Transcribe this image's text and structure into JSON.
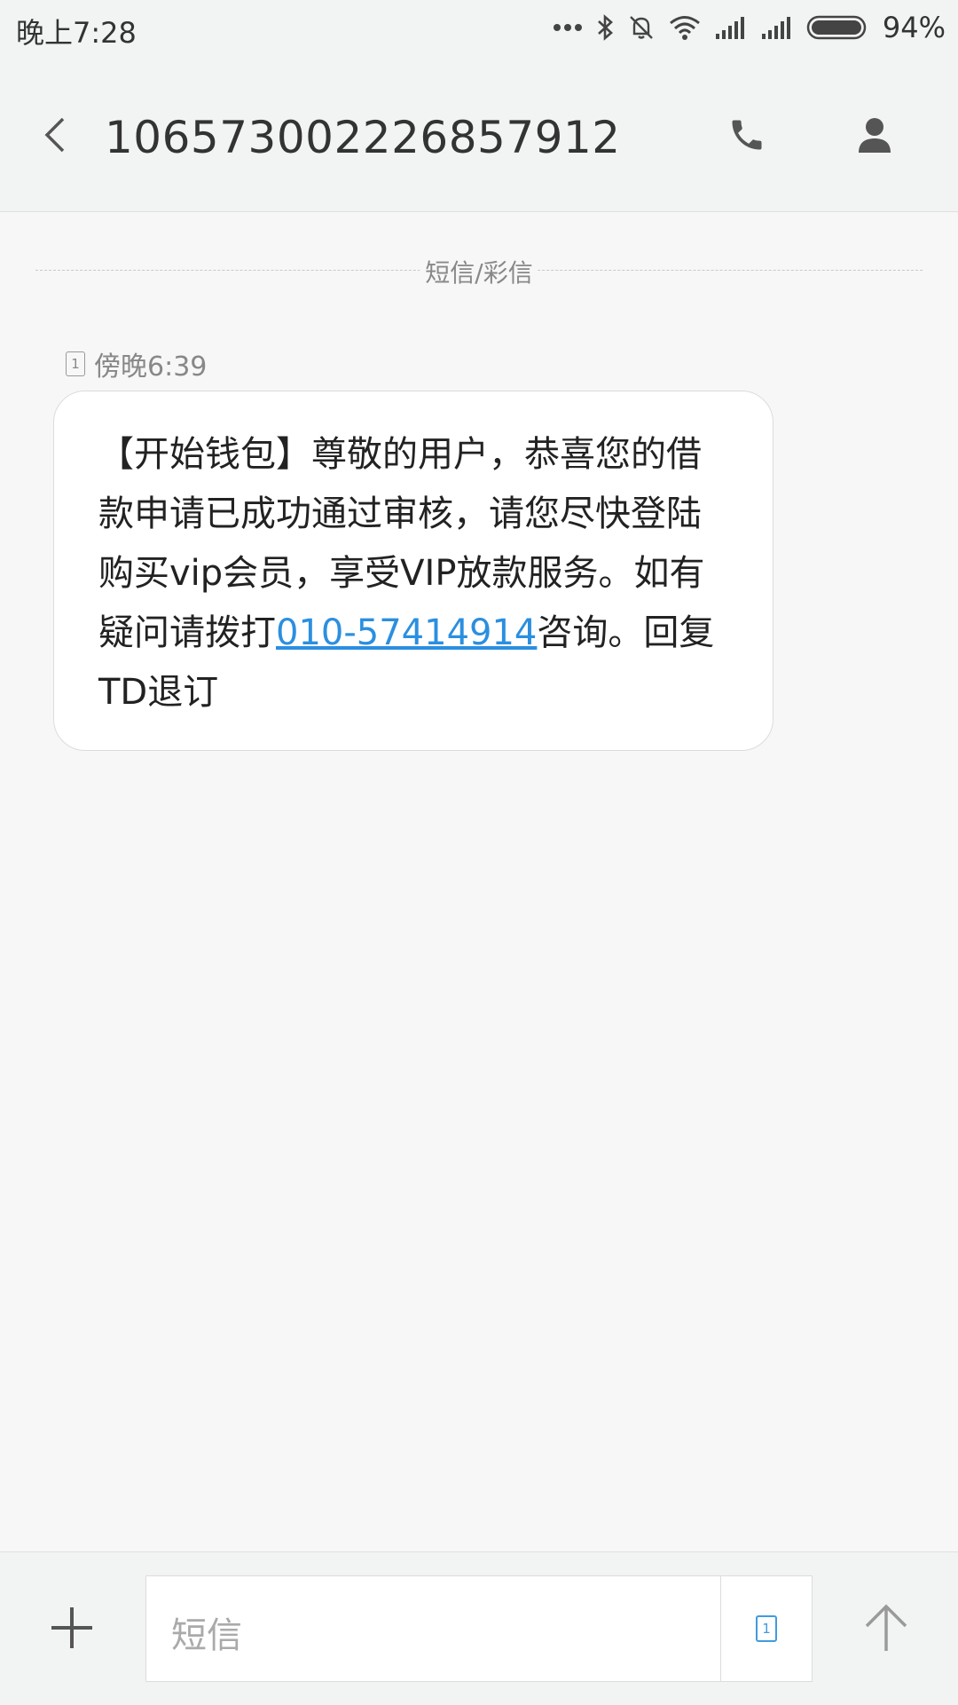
{
  "status_bar": {
    "time": "晚上7:28",
    "battery_percent": "94%",
    "icons": [
      "more-dots-icon",
      "bluetooth-icon",
      "bell-muted-icon",
      "wifi-icon",
      "signal-1-icon",
      "signal-2-icon",
      "battery-icon"
    ]
  },
  "header": {
    "title": "106573002226857912",
    "icons": [
      "back-arrow-icon",
      "phone-icon",
      "contact-icon"
    ]
  },
  "conversation": {
    "divider_label": "短信/彩信",
    "message": {
      "sim_slot": "1",
      "time": "傍晚6:39",
      "text_before_link": "【开始钱包】尊敬的用户，恭喜您的借款申请已成功通过审核，请您尽快登陆购买vip会员，享受VIP放款服务。如有疑问请拨打",
      "link_text": "010-57414914",
      "text_after_link": "咨询。回复TD退订"
    }
  },
  "composer": {
    "placeholder": "短信",
    "sim_slot": "1",
    "icons": [
      "plus-icon",
      "send-arrow-icon"
    ]
  },
  "colors": {
    "link": "#2b8fe0",
    "background": "#f7f7f7",
    "bar": "#f2f3f3"
  }
}
